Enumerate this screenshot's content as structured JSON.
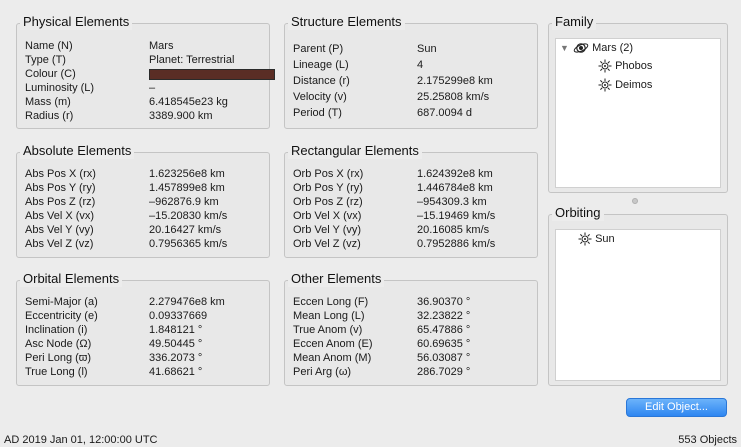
{
  "physical": {
    "title": "Physical Elements",
    "rows": [
      {
        "label": "Name (N)",
        "value": "Mars"
      },
      {
        "label": "Type (T)",
        "value": "Planet: Terrestrial"
      },
      {
        "label": "Colour (C)",
        "value": ""
      },
      {
        "label": "Luminosity (L)",
        "value": "–"
      },
      {
        "label": "Mass (m)",
        "value": "6.418545e23 kg"
      },
      {
        "label": "Radius (r)",
        "value": "3389.900 km"
      }
    ],
    "colour_hex": "#5a2d25"
  },
  "structure": {
    "title": "Structure Elements",
    "rows": [
      {
        "label": "Parent (P)",
        "value": "Sun"
      },
      {
        "label": "Lineage (L)",
        "value": "4"
      },
      {
        "label": "Distance (r)",
        "value": "2.175299e8 km"
      },
      {
        "label": "Velocity (v)",
        "value": "25.25808 km/s"
      },
      {
        "label": "Period (T)",
        "value": "687.0094 d"
      }
    ]
  },
  "absolute": {
    "title": "Absolute Elements",
    "rows": [
      {
        "label": "Abs Pos X (rx)",
        "value": "1.623256e8 km"
      },
      {
        "label": "Abs Pos Y (ry)",
        "value": "1.457899e8 km"
      },
      {
        "label": "Abs Pos Z (rz)",
        "value": "–962876.9 km"
      },
      {
        "label": "Abs Vel X (vx)",
        "value": "–15.20830 km/s"
      },
      {
        "label": "Abs Vel Y (vy)",
        "value": "20.16427 km/s"
      },
      {
        "label": "Abs Vel Z (vz)",
        "value": "0.7956365 km/s"
      }
    ]
  },
  "rectangular": {
    "title": "Rectangular Elements",
    "rows": [
      {
        "label": "Orb Pos X (rx)",
        "value": "1.624392e8 km"
      },
      {
        "label": "Orb Pos Y (ry)",
        "value": "1.446784e8 km"
      },
      {
        "label": "Orb Pos Z (rz)",
        "value": "–954309.3 km"
      },
      {
        "label": "Orb Vel X (vx)",
        "value": "–15.19469 km/s"
      },
      {
        "label": "Orb Vel Y (vy)",
        "value": "20.16085 km/s"
      },
      {
        "label": "Orb Vel Z (vz)",
        "value": "0.7952886 km/s"
      }
    ]
  },
  "orbital": {
    "title": "Orbital Elements",
    "rows": [
      {
        "label": "Semi-Major (a)",
        "value": "2.279476e8 km"
      },
      {
        "label": "Eccentricity (e)",
        "value": "0.09337669"
      },
      {
        "label": "Inclination (i)",
        "value": "1.848121 °"
      },
      {
        "label": "Asc Node (Ω)",
        "value": "49.50445 °"
      },
      {
        "label": "Peri Long (ϖ)",
        "value": "336.2073 °"
      },
      {
        "label": "True Long (l)",
        "value": "41.68621 °"
      }
    ]
  },
  "other": {
    "title": "Other Elements",
    "rows": [
      {
        "label": "Eccen Long (F)",
        "value": "36.90370 °"
      },
      {
        "label": "Mean Long (L)",
        "value": "32.23822 °"
      },
      {
        "label": "True Anom (v)",
        "value": "65.47886 °"
      },
      {
        "label": "Eccen Anom (E)",
        "value": "60.69635 °"
      },
      {
        "label": "Mean Anom (M)",
        "value": "56.03087 °"
      },
      {
        "label": "Peri Arg (ω)",
        "value": "286.7029 °"
      }
    ]
  },
  "family": {
    "title": "Family",
    "root": {
      "label": "Mars (2)",
      "icon": "planet-icon"
    },
    "children": [
      {
        "label": "Phobos",
        "icon": "sun-icon"
      },
      {
        "label": "Deimos",
        "icon": "sun-icon"
      }
    ]
  },
  "orbiting": {
    "title": "Orbiting",
    "items": [
      {
        "label": "Sun",
        "icon": "sun-icon"
      }
    ]
  },
  "actions": {
    "edit_label": "Edit Object..."
  },
  "status": {
    "date": "AD 2019 Jan 01, 12:00:00 UTC",
    "count": "553 Objects"
  },
  "colors": {
    "accent": "#2e86f1",
    "panel_bg": "#ffffff",
    "window_bg": "#ececec"
  }
}
